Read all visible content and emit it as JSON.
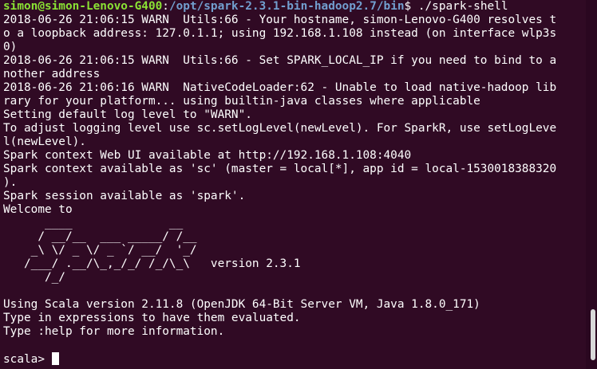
{
  "prompt": {
    "user_host": "simon@simon-Lenovo-G400",
    "sep": ":",
    "path": "/opt/spark-2.3.1-bin-hadoop2.7/bin",
    "symbol": "$ ",
    "command": "./spark-shell"
  },
  "output_lines": [
    "2018-06-26 21:06:15 WARN  Utils:66 - Your hostname, simon-Lenovo-G400 resolves t",
    "o a loopback address: 127.0.1.1; using 192.168.1.108 instead (on interface wlp3s",
    "0)",
    "2018-06-26 21:06:15 WARN  Utils:66 - Set SPARK_LOCAL_IP if you need to bind to a",
    "nother address",
    "2018-06-26 21:06:16 WARN  NativeCodeLoader:62 - Unable to load native-hadoop lib",
    "rary for your platform... using builtin-java classes where applicable",
    "Setting default log level to \"WARN\".",
    "To adjust logging level use sc.setLogLevel(newLevel). For SparkR, use setLogLeve",
    "l(newLevel).",
    "Spark context Web UI available at http://192.168.1.108:4040",
    "Spark context available as 'sc' (master = local[*], app id = local-1530018388320",
    ").",
    "Spark session available as 'spark'.",
    "Welcome to",
    "      ____              __",
    "     / __/__  ___ _____/ /__",
    "    _\\ \\/ _ \\/ _ `/ __/  '_/",
    "   /___/ .__/\\_,_/_/ /_/\\_\\   version 2.3.1",
    "      /_/",
    "",
    "Using Scala version 2.11.8 (OpenJDK 64-Bit Server VM, Java 1.8.0_171)",
    "Type in expressions to have them evaluated.",
    "Type :help for more information.",
    ""
  ],
  "repl_prompt": "scala> ",
  "colors": {
    "background": "#300a24",
    "foreground": "#ffffff",
    "user_host": "#8ae234",
    "path": "#729fcf"
  }
}
